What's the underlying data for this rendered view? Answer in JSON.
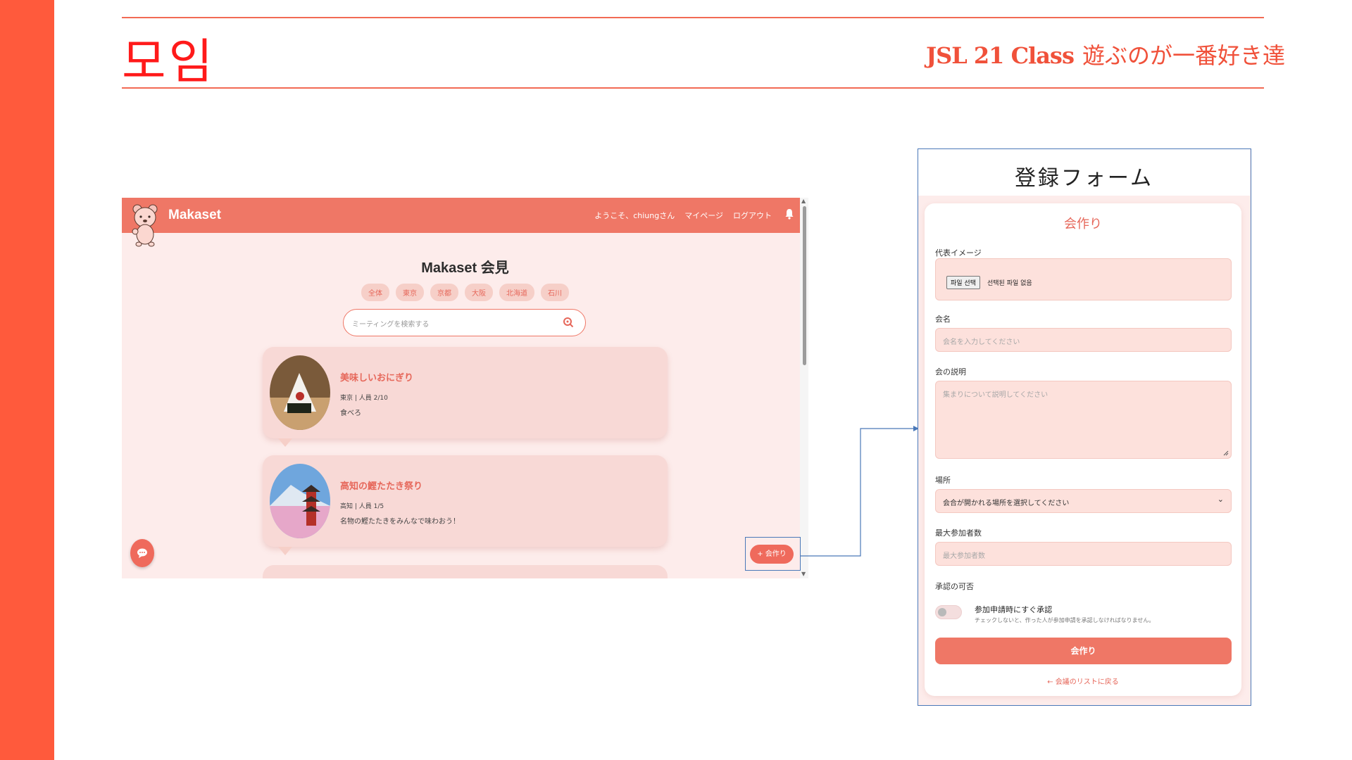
{
  "slide": {
    "title": "모임",
    "subtitle_bold": "JSL 21 Class",
    "subtitle_rest": "遊ぶのが一番好き達",
    "accent": "#ff5a3c"
  },
  "app": {
    "brand": "Makaset",
    "nav": {
      "welcome": "ようこそ、chiungさん",
      "mypage": "マイページ",
      "logout": "ログアウト"
    },
    "heading": "Makaset 会見",
    "chips": [
      "全体",
      "東京",
      "京都",
      "大阪",
      "北海道",
      "石川"
    ],
    "search_placeholder": "ミーティングを検索する",
    "cards": [
      {
        "title": "美味しいおにぎり",
        "meta": "東京 | 人員 2/10",
        "desc": "食べろ"
      },
      {
        "title": "高知の鰹たたき祭り",
        "meta": "高知 | 人員 1/5",
        "desc": "名物の鰹たたきをみんなで味わおう！"
      }
    ],
    "create_button": "+ 会作り",
    "theme_color": "#ef7766"
  },
  "form": {
    "window_title": "登録フォーム",
    "card_title": "会作り",
    "image_label": "代表イメージ",
    "file_button": "파일 선택",
    "file_status": "선택된 파일 없음",
    "name_label": "会名",
    "name_placeholder": "会名を入力してください",
    "desc_label": "会の説明",
    "desc_placeholder": "集まりについて説明してください",
    "place_label": "場所",
    "place_selected": "会合が開かれる場所を選択してください",
    "max_label": "最大参加者数",
    "max_placeholder": "最大参加者数",
    "approval_label": "承認の可否",
    "approval_toggle_label": "参加申請時にすぐ承認",
    "approval_help": "チェックしないと、作った人が参加申請を承認しなければなりません。",
    "approval_on": false,
    "submit": "会作り",
    "back_link": "← 会議のリストに戻る"
  }
}
